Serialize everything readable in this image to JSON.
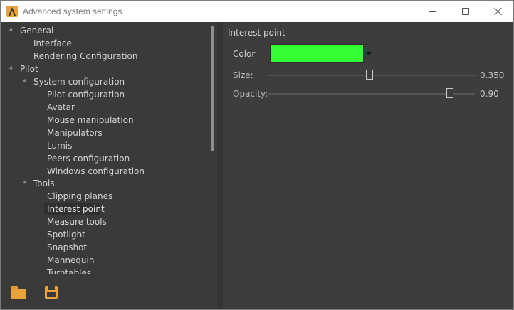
{
  "window": {
    "title": "Advanced system settings"
  },
  "tree": {
    "items": [
      {
        "label": "General",
        "expanded": true
      },
      {
        "label": "Interface"
      },
      {
        "label": "Rendering Configuration"
      },
      {
        "label": "Pilot",
        "expanded": true
      },
      {
        "label": "System configuration",
        "expanded": true
      },
      {
        "label": "Pilot configuration"
      },
      {
        "label": "Avatar"
      },
      {
        "label": "Mouse manipulation"
      },
      {
        "label": "Manipulators"
      },
      {
        "label": "Lumis"
      },
      {
        "label": "Peers configuration"
      },
      {
        "label": "Windows configuration"
      },
      {
        "label": "Tools",
        "expanded": true
      },
      {
        "label": "Clipping planes"
      },
      {
        "label": "Interest point",
        "selected": true
      },
      {
        "label": "Measure tools"
      },
      {
        "label": "Spotlight"
      },
      {
        "label": "Snapshot"
      },
      {
        "label": "Mannequin"
      },
      {
        "label": "Turntables"
      }
    ]
  },
  "toolbar": {
    "open_icon": "folder-open-icon",
    "save_icon": "floppy-disk-icon"
  },
  "panel": {
    "title": "Interest point",
    "color": {
      "label": "Color",
      "value": "#33ff33"
    },
    "size": {
      "label": "Size:",
      "value": "0.350",
      "position": 0.51
    },
    "opacity": {
      "label": "Opacity:",
      "value": "0.90",
      "position": 0.9
    }
  },
  "colors": {
    "accent": "#e8a33d",
    "background": "#3c3c3c"
  }
}
